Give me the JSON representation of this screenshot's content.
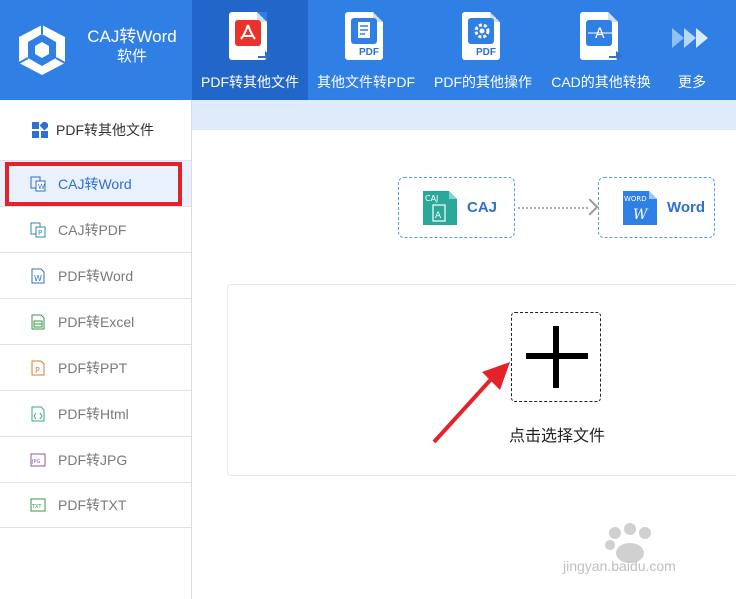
{
  "app": {
    "name_line1": "CAJ转Word",
    "name_line2": "软件"
  },
  "toolbar": {
    "items": [
      {
        "label": "PDF转其他文件",
        "icon": "pdf-acrobat-icon",
        "active": true
      },
      {
        "label": "其他文件转PDF",
        "icon": "document-to-pdf-icon"
      },
      {
        "label": "PDF的其他操作",
        "icon": "gear-pdf-icon"
      },
      {
        "label": "CAD的其他转换",
        "icon": "cad-convert-icon"
      },
      {
        "label": "更多",
        "icon": "double-chevron-right-icon"
      }
    ],
    "pdf_tag": "PDF"
  },
  "sidebar": {
    "header": "PDF转其他文件",
    "items": [
      {
        "label": "CAJ转Word",
        "icon": "caj-word-icon",
        "active": true
      },
      {
        "label": "CAJ转PDF",
        "icon": "caj-pdf-icon"
      },
      {
        "label": "PDF转Word",
        "icon": "word-file-icon"
      },
      {
        "label": "PDF转Excel",
        "icon": "excel-file-icon"
      },
      {
        "label": "PDF转PPT",
        "icon": "ppt-file-icon"
      },
      {
        "label": "PDF转Html",
        "icon": "html-file-icon"
      },
      {
        "label": "PDF转JPG",
        "icon": "jpg-file-icon"
      },
      {
        "label": "PDF转TXT",
        "icon": "txt-file-icon"
      }
    ]
  },
  "main": {
    "from_format": "CAJ",
    "to_format": "Word",
    "from_badge": "CAJ",
    "to_badge": "WORD",
    "choose_file_label": "点击选择文件"
  },
  "watermark": {
    "text": "jingyan.baidu.com"
  },
  "colors": {
    "toolbar_bg": "#2f7fe4",
    "toolbar_active": "#2366c9",
    "accent": "#2f6fd0",
    "highlight_red": "#e3222a"
  }
}
